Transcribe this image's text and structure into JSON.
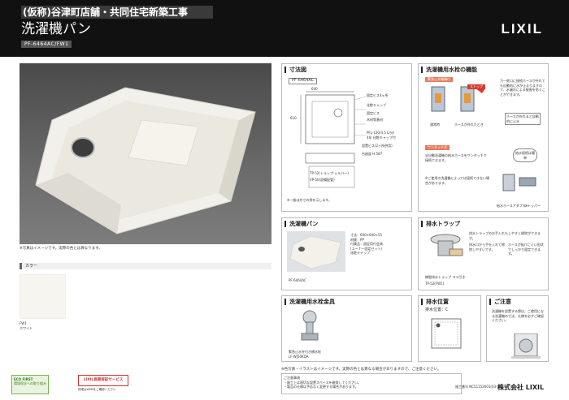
{
  "header": {
    "title": "(仮称)谷津町店舗・共同住宅新築工事",
    "subtitle": "洗濯機パン",
    "model_code": "PF-6464AC/FW1",
    "logo": "LIXIL"
  },
  "left": {
    "photo_note": "※写真はイメージです。実際の色とは異なります。",
    "color_heading": "カラー",
    "color_code": "FW1",
    "color_name": "ホワイト"
  },
  "badges": {
    "eco_label": "ECO FIRST",
    "eco_note": "環境保全への取り組み",
    "warranty_label": "LIXIL長期保証サービス",
    "warranty_note": "詳細はWEBをご確認ください"
  },
  "panels": {
    "dimensions": {
      "title": "寸法図",
      "model": "PF-6464AC",
      "note": "※一般は外寸の例を示します。",
      "labels": [
        "640",
        "610",
        "固定ビス4ヶ所",
        "化粧キャップ",
        "固定ビス",
        "木材等基材",
        "PFL-120(4.5 L/分)",
        "4年 化粧キャップ付",
        "設置ビス(2ヶ所併用)",
        "台座部 H:587",
        "TP-52(トラップ:シルバー)",
        "VP-50(設備配管)"
      ]
    },
    "faucet": {
      "title": "洗濯機用水栓の機能",
      "tag1": "緊急止水機構付",
      "tag2": "ストップ",
      "desc1": "万一蛇口に接続ホースが外れても自動的に水が止まりますので、水漏れによる被害を防ぐことができます。",
      "label_normal": "通常時",
      "label_detached": "ホースが外れたとき",
      "callout": "ホースが外れると自動的に止水",
      "tag3": "ワンタッチ式",
      "desc2": "全自動洗濯機の給水ホースをワンタッチで接続できます。",
      "callout2": "給水接続は簡単",
      "note": "※ご使用の洗濯機によっては接続できない場合があります。",
      "label_adapter": "給水ホースアダプター",
      "label_nut": "ストッパー"
    },
    "pan": {
      "title": "洗濯機パン",
      "specs": [
        "寸法：640×640×55",
        "材質：PP",
        "付属品：固定用付会具",
        "(コーナー固定セット)",
        "化粧キャップ"
      ],
      "model": "PF-6464AC"
    },
    "trap": {
      "title": "排水トラップ",
      "desc": "排水トラップのお手入れもしやすく掃除ができます。",
      "text1": "排水口から手を入れて掃除しやすいです。",
      "text2": "ホースが抜けにくい形状でしっかり固定できます。",
      "model": "TP-52(FW1)",
      "caption": "樹脂排水トラップ ヨコ引き"
    },
    "faucet_parts": {
      "title": "洗濯機用水栓金具",
      "caption1": "緊急止水弁付き横水栓",
      "caption2": "LF-WJ50KQA"
    },
    "drain_position": {
      "title": "排水位置",
      "value": "排水位置：C"
    },
    "caution": {
      "title": "ご注意",
      "text": "洗濯機を設置する際は、ご使用になる洗濯機の寸法、仕様を必ずご確認ください。"
    }
  },
  "footer": {
    "note": "※色写真・イラストはイメージです。実際の色とは異なる場合がありますので、ご注意ください。",
    "box_lines": [
      "ご注意事項",
      "・施工上は適切な設置スペースを確保してください。",
      "・製品の仕様は予告なく変更する場合があります。"
    ],
    "code": "施工番号 NC51152001(03-023-13",
    "company": "株式会社 LIXIL"
  },
  "colors": {
    "header_bg": "#111111",
    "accent": "#e8795a",
    "swatch": "#f7f5ef"
  }
}
